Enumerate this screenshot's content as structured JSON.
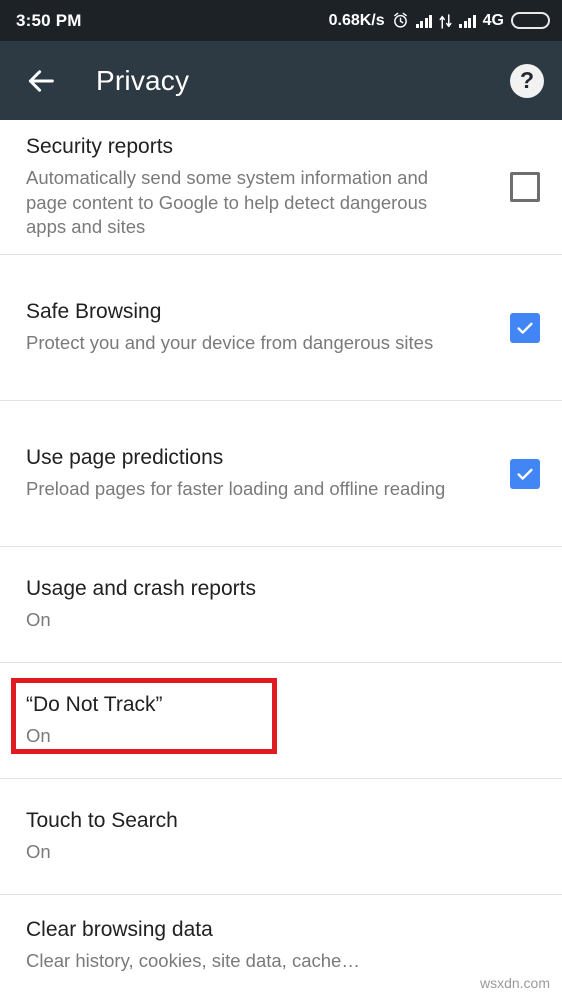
{
  "status_bar": {
    "time": "3:50 PM",
    "network_speed": "0.68K/s",
    "alarm_icon": "alarm-clock-icon",
    "signal_icon_1": "signal-bars-icon",
    "data_transfer_icon": "data-transfer-arrows-icon",
    "signal_icon_2": "signal-bars-icon",
    "network_type": "4G",
    "battery_icon": "battery-icon",
    "background_color": "#1d2226"
  },
  "toolbar": {
    "back_icon": "back-arrow-icon",
    "title": "Privacy",
    "help_icon": "help-question-mark-icon",
    "background_color": "#2d3a43"
  },
  "settings": [
    {
      "title": "Security reports",
      "summary": "Automatically send some system information and page content to Google to help detect dangerous apps and sites",
      "control": "checkbox",
      "checked": false
    },
    {
      "title": "Safe Browsing",
      "summary": "Protect you and your device from dangerous sites",
      "control": "checkbox",
      "checked": true
    },
    {
      "title": "Use page predictions",
      "summary": "Preload pages for faster loading and offline reading",
      "control": "checkbox",
      "checked": true
    },
    {
      "title": "Usage and crash reports",
      "summary": "On",
      "control": "none",
      "checked": null
    },
    {
      "title": "“Do Not Track”",
      "summary": "On",
      "control": "none",
      "checked": null,
      "highlighted": true
    },
    {
      "title": "Touch to Search",
      "summary": "On",
      "control": "none",
      "checked": null
    },
    {
      "title": "Clear browsing data",
      "summary": "Clear history, cookies, site data, cache…",
      "control": "none",
      "checked": null
    }
  ],
  "annotation": {
    "color": "#e01b22",
    "target": "“Do Not Track”"
  },
  "watermark": "wsxdn.com",
  "colors": {
    "checkbox_on": "#4285f4",
    "checkbox_off_border": "#6e6e6e",
    "title_text": "#212121",
    "summary_text": "#7a7a7a",
    "divider": "#e3e3e3"
  }
}
